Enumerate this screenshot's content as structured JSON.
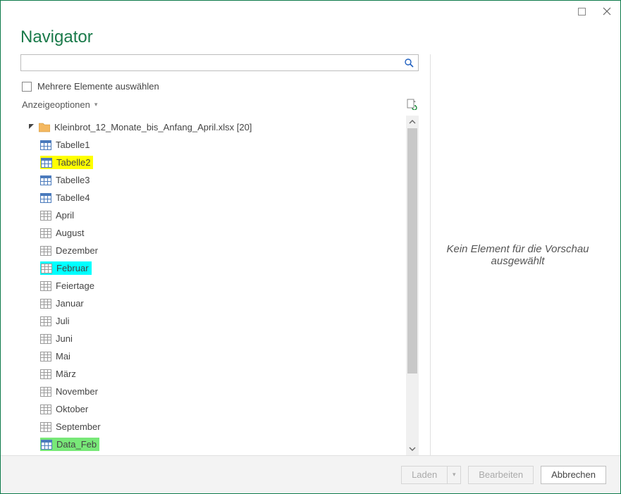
{
  "window": {
    "title": "Navigator"
  },
  "search": {
    "placeholder": "",
    "value": ""
  },
  "multiSelect": {
    "label": "Mehrere Elemente auswählen",
    "checked": false
  },
  "displayOptions": {
    "label": "Anzeigeoptionen"
  },
  "file": {
    "name": "Kleinbrot_12_Monate_bis_Anfang_April.xlsx",
    "count": "[20]",
    "expanded": true
  },
  "items": [
    {
      "label": "Tabelle1",
      "type": "table",
      "highlight": "none"
    },
    {
      "label": "Tabelle2",
      "type": "table",
      "highlight": "yellow"
    },
    {
      "label": "Tabelle3",
      "type": "table",
      "highlight": "none"
    },
    {
      "label": "Tabelle4",
      "type": "table",
      "highlight": "none"
    },
    {
      "label": "April",
      "type": "sheet",
      "highlight": "none"
    },
    {
      "label": "August",
      "type": "sheet",
      "highlight": "none"
    },
    {
      "label": "Dezember",
      "type": "sheet",
      "highlight": "none"
    },
    {
      "label": "Februar",
      "type": "sheet",
      "highlight": "cyan"
    },
    {
      "label": "Feiertage",
      "type": "sheet",
      "highlight": "none"
    },
    {
      "label": "Januar",
      "type": "sheet",
      "highlight": "none"
    },
    {
      "label": "Juli",
      "type": "sheet",
      "highlight": "none"
    },
    {
      "label": "Juni",
      "type": "sheet",
      "highlight": "none"
    },
    {
      "label": "Mai",
      "type": "sheet",
      "highlight": "none"
    },
    {
      "label": "März",
      "type": "sheet",
      "highlight": "none"
    },
    {
      "label": "November",
      "type": "sheet",
      "highlight": "none"
    },
    {
      "label": "Oktober",
      "type": "sheet",
      "highlight": "none"
    },
    {
      "label": "September",
      "type": "sheet",
      "highlight": "none"
    },
    {
      "label": "Data_Feb",
      "type": "table",
      "highlight": "green"
    }
  ],
  "preview": {
    "emptyText": "Kein Element für die Vorschau ausgewählt"
  },
  "buttons": {
    "load": "Laden",
    "edit": "Bearbeiten",
    "cancel": "Abbrechen",
    "loadEnabled": false,
    "editEnabled": false
  }
}
